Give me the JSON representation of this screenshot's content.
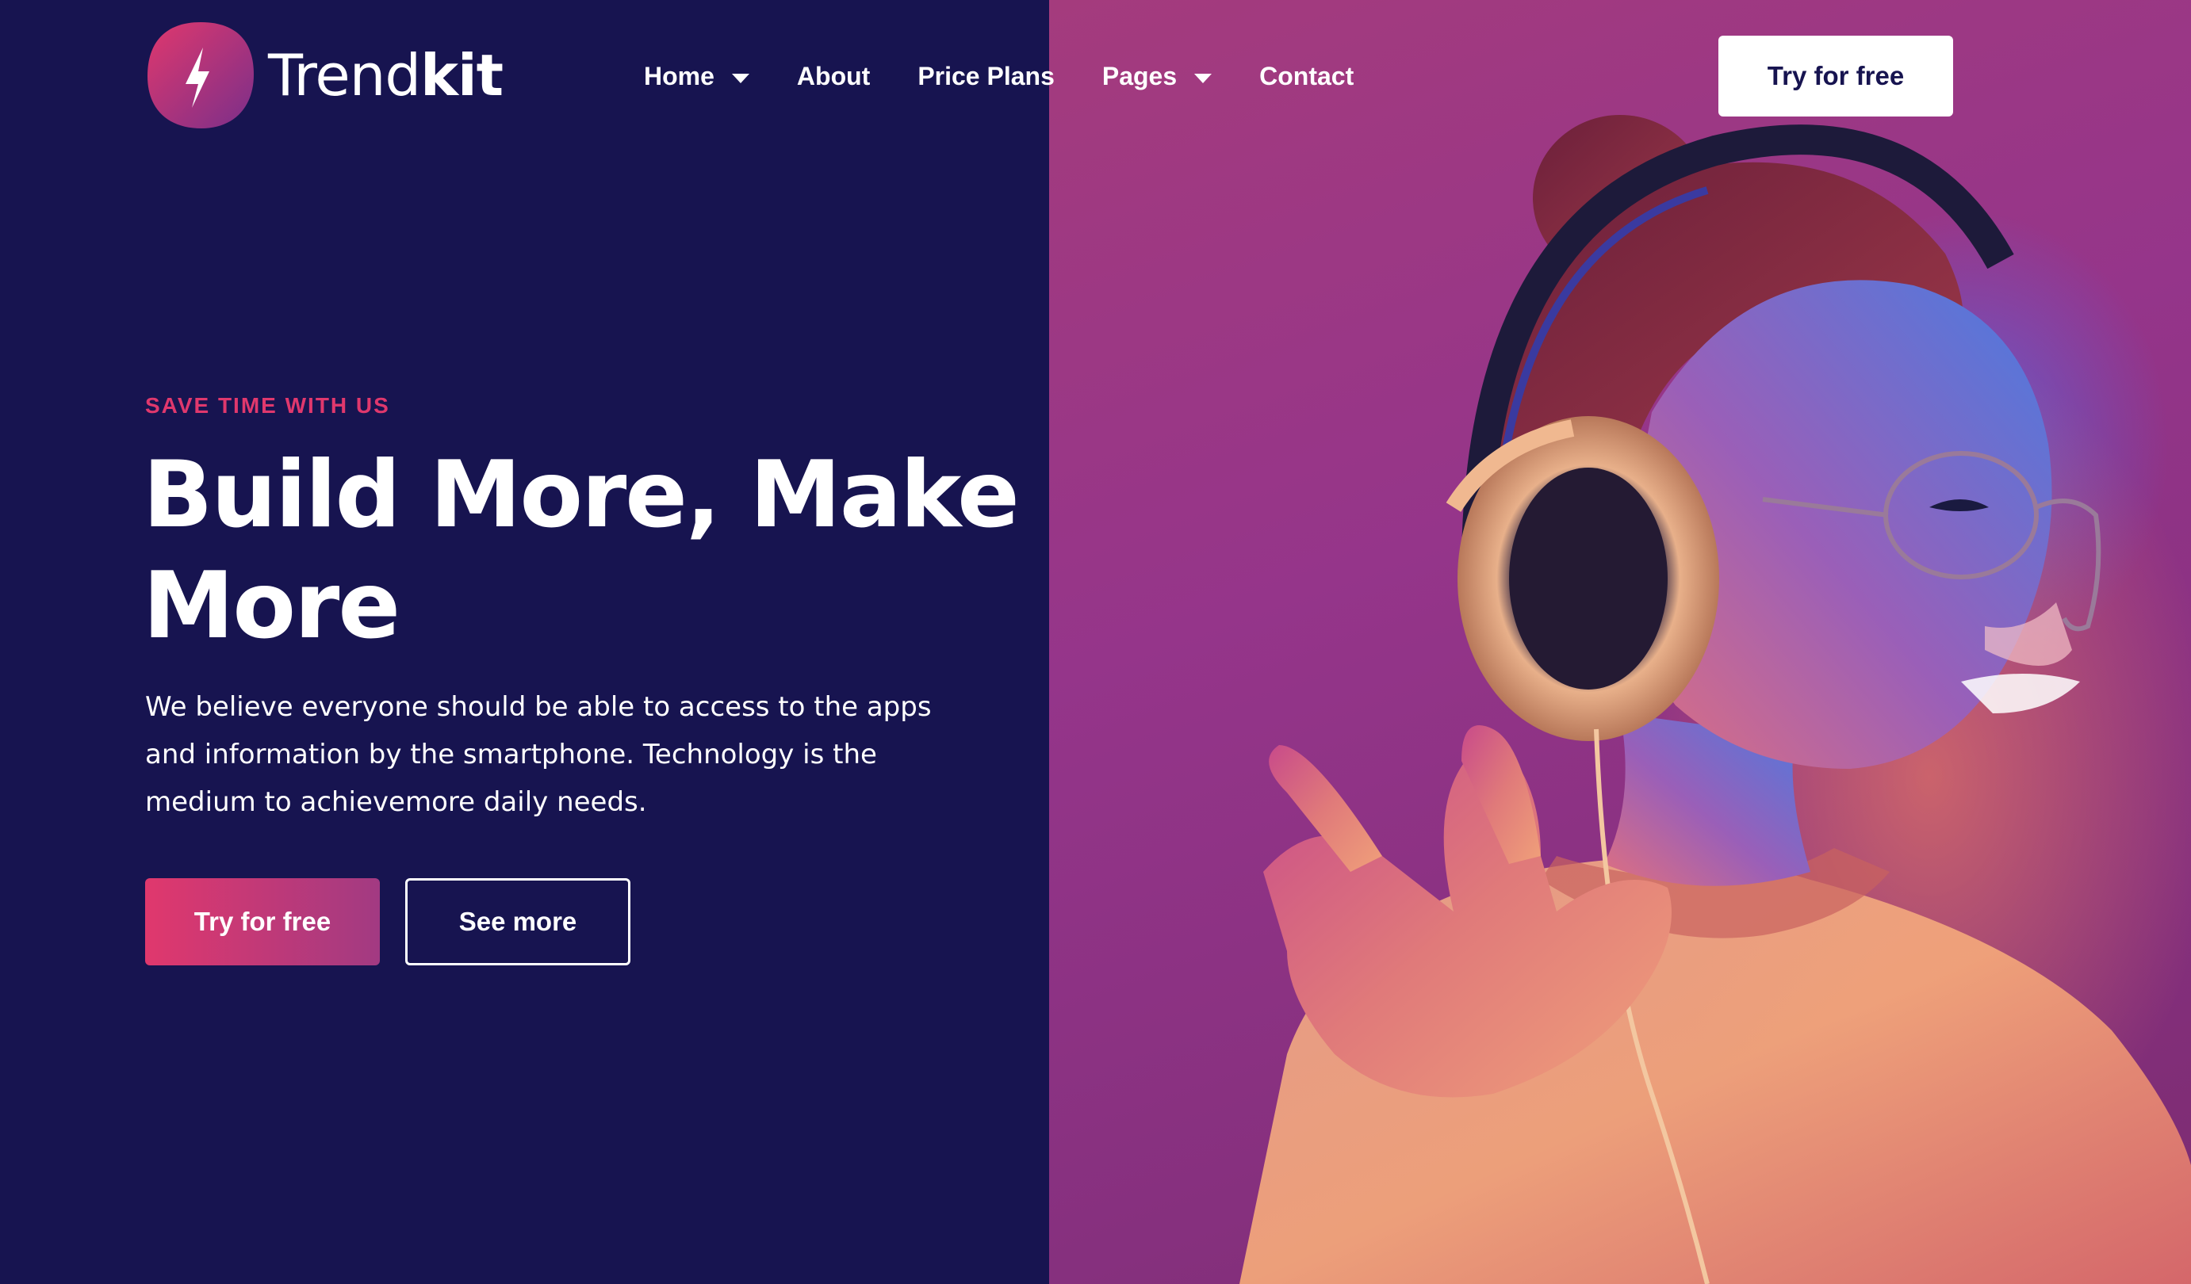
{
  "brand": {
    "name_light": "Trend",
    "name_bold": "kit",
    "logo_icon": "trendkit-logo-icon"
  },
  "nav": {
    "items": [
      {
        "label": "Home",
        "has_dropdown": true
      },
      {
        "label": "About",
        "has_dropdown": false
      },
      {
        "label": "Price Plans",
        "has_dropdown": false
      },
      {
        "label": "Pages",
        "has_dropdown": true
      },
      {
        "label": "Contact",
        "has_dropdown": false
      }
    ],
    "cta_label": "Try for free"
  },
  "hero": {
    "eyebrow": "SAVE TIME WITH US",
    "headline": "Build More, Make More",
    "lead": "We believe everyone should be able to access to the apps and information by the smartphone. Technology is the medium to achievemore daily needs.",
    "primary_button": "Try for free",
    "secondary_button": "See more",
    "image": "woman-with-headphones-photo"
  },
  "colors": {
    "background": "#171450",
    "accent": "#e0386d",
    "accent_gradient_end": "#a23a82",
    "image_tint": "#95358a",
    "text": "#ffffff"
  }
}
